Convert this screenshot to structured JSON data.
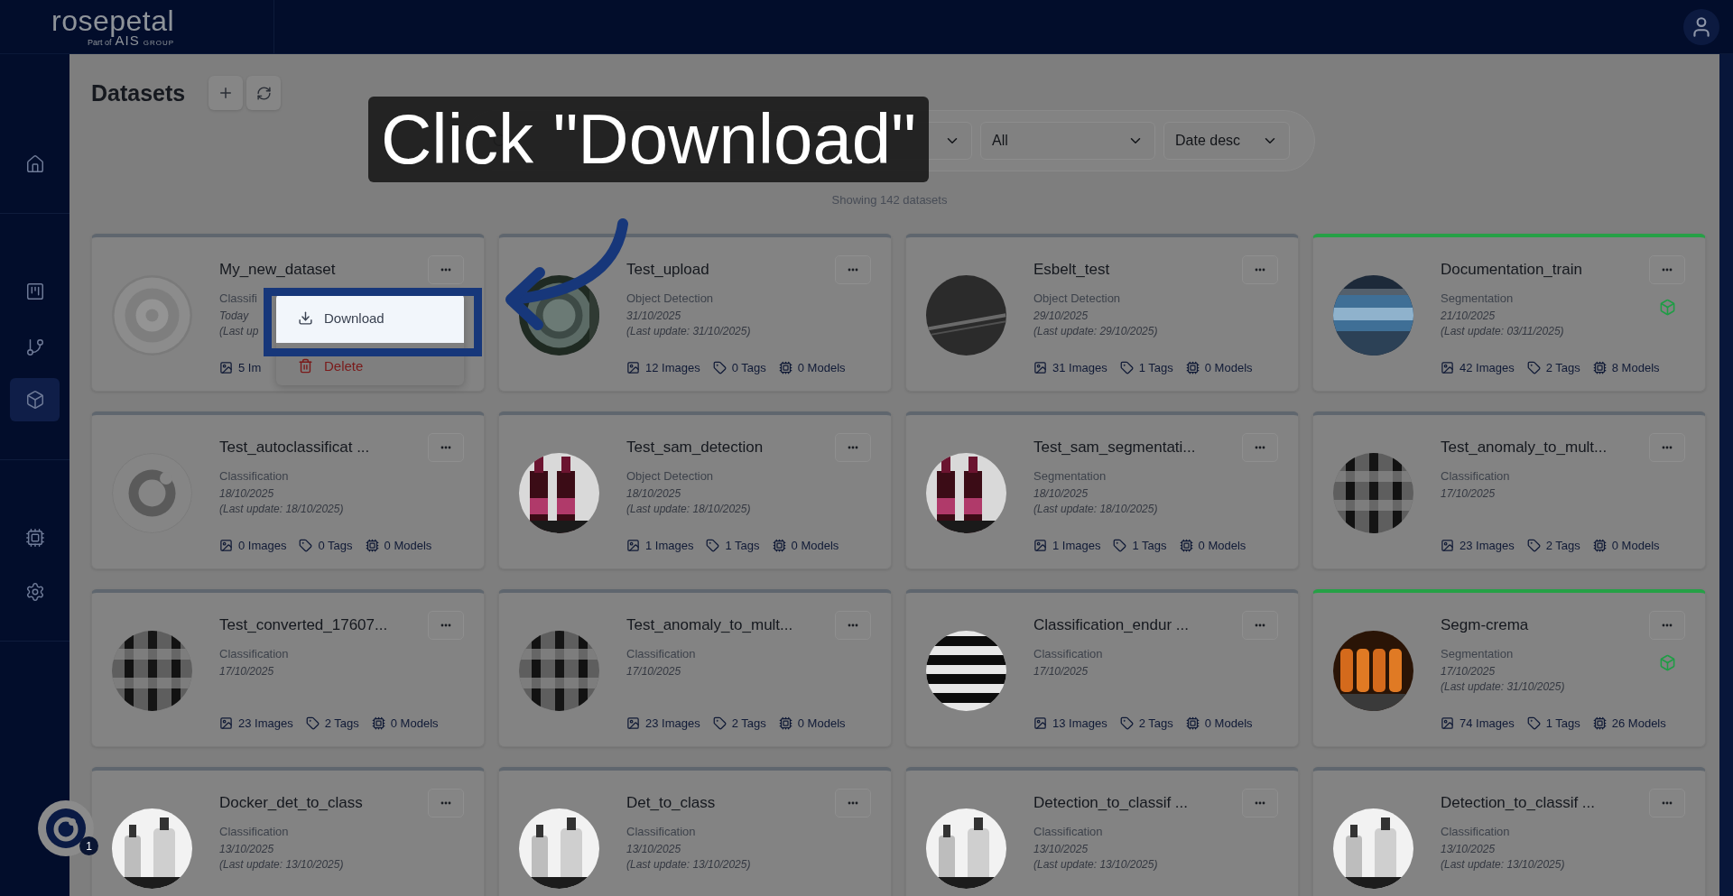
{
  "header": {
    "logo": {
      "name": "rosepetal",
      "tagline": "Part of",
      "group": "AIS",
      "group_sub": "GROUP"
    }
  },
  "sidebar": {
    "items": [
      {
        "selected": false
      },
      {
        "selected": false
      },
      {
        "selected": false
      },
      {
        "selected": true
      },
      {
        "selected": false
      },
      {
        "selected": false
      }
    ]
  },
  "page": {
    "title": "Datasets"
  },
  "filters": {
    "selects": [
      {
        "value": "All"
      },
      {
        "value": "Date desc"
      }
    ]
  },
  "summary": "Showing 142 datasets",
  "datasets": [
    {
      "name": "My_new_dataset",
      "type": "Classifi",
      "date": "Today",
      "last_update": "(Last up",
      "images": "5 Im",
      "deployed": false
    },
    {
      "name": "Test_upload",
      "type": "Object Detection",
      "date": "31/10/2025",
      "last_update": "(Last update: 31/10/2025)",
      "images": "12 Images",
      "tags": "0 Tags",
      "models": "0 Models",
      "deployed": false
    },
    {
      "name": "Esbelt_test",
      "type": "Object Detection",
      "date": "29/10/2025",
      "last_update": "(Last update: 29/10/2025)",
      "images": "31 Images",
      "tags": "1 Tags",
      "models": "0 Models",
      "deployed": false
    },
    {
      "name": "Documentation_train",
      "type": "Segmentation",
      "date": "21/10/2025",
      "last_update": "(Last update: 03/11/2025)",
      "images": "42 Images",
      "tags": "2 Tags",
      "models": "8 Models",
      "deployed": true
    },
    {
      "name": "Test_autoclassificat ...",
      "type": "Classification",
      "date": "18/10/2025",
      "last_update": "(Last update: 18/10/2025)",
      "images": "0 Images",
      "tags": "0 Tags",
      "models": "0 Models",
      "deployed": false
    },
    {
      "name": "Test_sam_detection",
      "type": "Object Detection",
      "date": "18/10/2025",
      "last_update": "(Last update: 18/10/2025)",
      "images": "1 Images",
      "tags": "1 Tags",
      "models": "0 Models",
      "deployed": false
    },
    {
      "name": "Test_sam_segmentati...",
      "type": "Segmentation",
      "date": "18/10/2025",
      "last_update": "(Last update: 18/10/2025)",
      "images": "1 Images",
      "tags": "1 Tags",
      "models": "0 Models",
      "deployed": false
    },
    {
      "name": "Test_anomaly_to_mult...",
      "type": "Classification",
      "date": "17/10/2025",
      "images": "23 Images",
      "tags": "2 Tags",
      "models": "0 Models",
      "deployed": false
    },
    {
      "name": "Test_converted_17607...",
      "type": "Classification",
      "date": "17/10/2025",
      "images": "23 Images",
      "tags": "2 Tags",
      "models": "0 Models",
      "deployed": false
    },
    {
      "name": "Test_anomaly_to_mult...",
      "type": "Classification",
      "date": "17/10/2025",
      "images": "23 Images",
      "tags": "2 Tags",
      "models": "0 Models",
      "deployed": false
    },
    {
      "name": "Classification_endur ...",
      "type": "Classification",
      "date": "17/10/2025",
      "images": "13 Images",
      "tags": "2 Tags",
      "models": "0 Models",
      "deployed": false
    },
    {
      "name": "Segm-crema",
      "type": "Segmentation",
      "date": "17/10/2025",
      "last_update": "(Last update: 31/10/2025)",
      "images": "74 Images",
      "tags": "1 Tags",
      "models": "26 Models",
      "deployed": true
    },
    {
      "name": "Docker_det_to_class",
      "type": "Classification",
      "date": "13/10/2025",
      "last_update": "(Last update: 13/10/2025)",
      "deployed": false
    },
    {
      "name": "Det_to_class",
      "type": "Classification",
      "date": "13/10/2025",
      "last_update": "(Last update: 13/10/2025)",
      "deployed": false
    },
    {
      "name": "Detection_to_classif ...",
      "type": "Classification",
      "date": "13/10/2025",
      "last_update": "(Last update: 13/10/2025)",
      "deployed": false
    },
    {
      "name": "Detection_to_classif ...",
      "type": "Classification",
      "date": "13/10/2025",
      "last_update": "(Last update: 13/10/2025)",
      "deployed": false
    }
  ],
  "dataset_menu": {
    "items": [
      {
        "label": "Download",
        "kind": "download",
        "highlighted": true
      },
      {
        "label": "Delete",
        "kind": "delete",
        "highlighted": false
      }
    ]
  },
  "tutorial": {
    "callout": "Click \"Download\""
  },
  "help_widget": {
    "badge": "1"
  }
}
